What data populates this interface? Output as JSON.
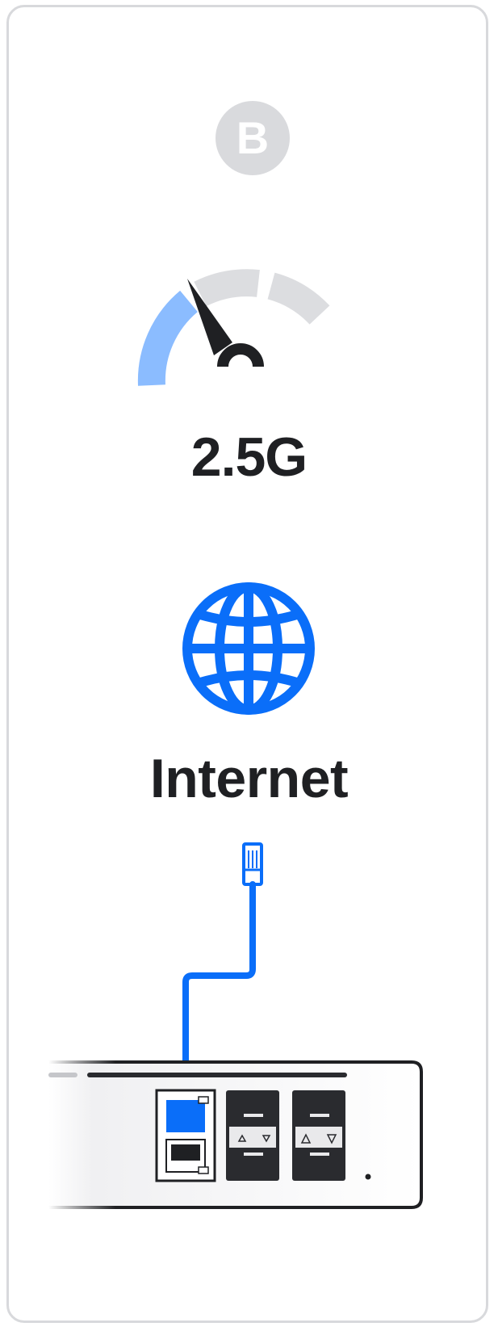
{
  "badge": {
    "letter": "B"
  },
  "speed": {
    "label": "2.5G"
  },
  "destination": {
    "label": "Internet",
    "icon": "globe-icon"
  },
  "colors": {
    "accent": "#0a6ef9",
    "gauge_fill": "#8bbcff",
    "gauge_track": "#dcdde0",
    "text": "#1f2023"
  }
}
